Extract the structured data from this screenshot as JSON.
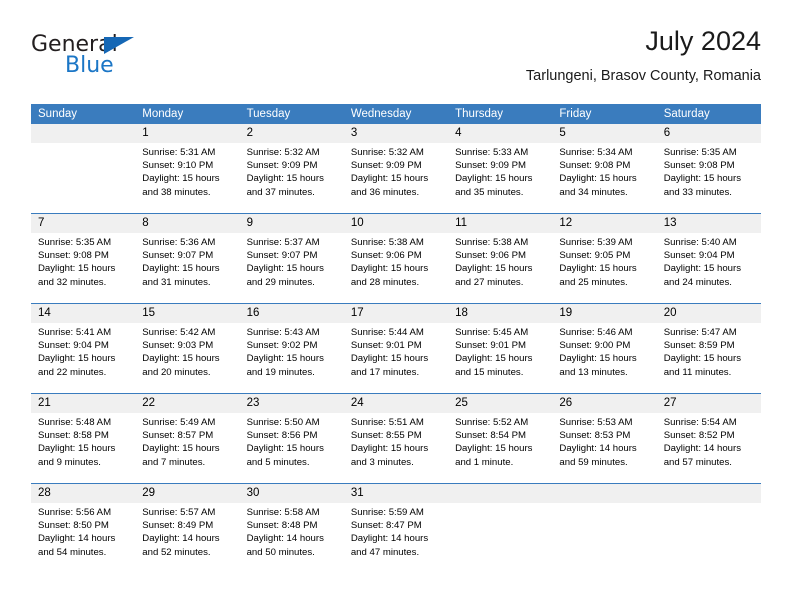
{
  "logo": {
    "word_one": "General",
    "word_two": "Blue",
    "triangle_color": "#1567b5",
    "blue_color": "#1b76c6"
  },
  "header": {
    "title": "July 2024",
    "subtitle": "Tarlungeni, Brasov County, Romania"
  },
  "theme": {
    "header_blue": "#3a7cbe",
    "date_band_gray": "#f0f0f0",
    "text_color": "#000000"
  },
  "calendar": {
    "weekday_headers": [
      "Sunday",
      "Monday",
      "Tuesday",
      "Wednesday",
      "Thursday",
      "Friday",
      "Saturday"
    ],
    "weeks": [
      {
        "days": [
          {
            "date": "",
            "sunrise": "",
            "sunset": "",
            "daylight_line1": "",
            "daylight_line2": ""
          },
          {
            "date": "1",
            "sunrise": "Sunrise: 5:31 AM",
            "sunset": "Sunset: 9:10 PM",
            "daylight_line1": "Daylight: 15 hours",
            "daylight_line2": "and 38 minutes."
          },
          {
            "date": "2",
            "sunrise": "Sunrise: 5:32 AM",
            "sunset": "Sunset: 9:09 PM",
            "daylight_line1": "Daylight: 15 hours",
            "daylight_line2": "and 37 minutes."
          },
          {
            "date": "3",
            "sunrise": "Sunrise: 5:32 AM",
            "sunset": "Sunset: 9:09 PM",
            "daylight_line1": "Daylight: 15 hours",
            "daylight_line2": "and 36 minutes."
          },
          {
            "date": "4",
            "sunrise": "Sunrise: 5:33 AM",
            "sunset": "Sunset: 9:09 PM",
            "daylight_line1": "Daylight: 15 hours",
            "daylight_line2": "and 35 minutes."
          },
          {
            "date": "5",
            "sunrise": "Sunrise: 5:34 AM",
            "sunset": "Sunset: 9:08 PM",
            "daylight_line1": "Daylight: 15 hours",
            "daylight_line2": "and 34 minutes."
          },
          {
            "date": "6",
            "sunrise": "Sunrise: 5:35 AM",
            "sunset": "Sunset: 9:08 PM",
            "daylight_line1": "Daylight: 15 hours",
            "daylight_line2": "and 33 minutes."
          }
        ]
      },
      {
        "days": [
          {
            "date": "7",
            "sunrise": "Sunrise: 5:35 AM",
            "sunset": "Sunset: 9:08 PM",
            "daylight_line1": "Daylight: 15 hours",
            "daylight_line2": "and 32 minutes."
          },
          {
            "date": "8",
            "sunrise": "Sunrise: 5:36 AM",
            "sunset": "Sunset: 9:07 PM",
            "daylight_line1": "Daylight: 15 hours",
            "daylight_line2": "and 31 minutes."
          },
          {
            "date": "9",
            "sunrise": "Sunrise: 5:37 AM",
            "sunset": "Sunset: 9:07 PM",
            "daylight_line1": "Daylight: 15 hours",
            "daylight_line2": "and 29 minutes."
          },
          {
            "date": "10",
            "sunrise": "Sunrise: 5:38 AM",
            "sunset": "Sunset: 9:06 PM",
            "daylight_line1": "Daylight: 15 hours",
            "daylight_line2": "and 28 minutes."
          },
          {
            "date": "11",
            "sunrise": "Sunrise: 5:38 AM",
            "sunset": "Sunset: 9:06 PM",
            "daylight_line1": "Daylight: 15 hours",
            "daylight_line2": "and 27 minutes."
          },
          {
            "date": "12",
            "sunrise": "Sunrise: 5:39 AM",
            "sunset": "Sunset: 9:05 PM",
            "daylight_line1": "Daylight: 15 hours",
            "daylight_line2": "and 25 minutes."
          },
          {
            "date": "13",
            "sunrise": "Sunrise: 5:40 AM",
            "sunset": "Sunset: 9:04 PM",
            "daylight_line1": "Daylight: 15 hours",
            "daylight_line2": "and 24 minutes."
          }
        ]
      },
      {
        "days": [
          {
            "date": "14",
            "sunrise": "Sunrise: 5:41 AM",
            "sunset": "Sunset: 9:04 PM",
            "daylight_line1": "Daylight: 15 hours",
            "daylight_line2": "and 22 minutes."
          },
          {
            "date": "15",
            "sunrise": "Sunrise: 5:42 AM",
            "sunset": "Sunset: 9:03 PM",
            "daylight_line1": "Daylight: 15 hours",
            "daylight_line2": "and 20 minutes."
          },
          {
            "date": "16",
            "sunrise": "Sunrise: 5:43 AM",
            "sunset": "Sunset: 9:02 PM",
            "daylight_line1": "Daylight: 15 hours",
            "daylight_line2": "and 19 minutes."
          },
          {
            "date": "17",
            "sunrise": "Sunrise: 5:44 AM",
            "sunset": "Sunset: 9:01 PM",
            "daylight_line1": "Daylight: 15 hours",
            "daylight_line2": "and 17 minutes."
          },
          {
            "date": "18",
            "sunrise": "Sunrise: 5:45 AM",
            "sunset": "Sunset: 9:01 PM",
            "daylight_line1": "Daylight: 15 hours",
            "daylight_line2": "and 15 minutes."
          },
          {
            "date": "19",
            "sunrise": "Sunrise: 5:46 AM",
            "sunset": "Sunset: 9:00 PM",
            "daylight_line1": "Daylight: 15 hours",
            "daylight_line2": "and 13 minutes."
          },
          {
            "date": "20",
            "sunrise": "Sunrise: 5:47 AM",
            "sunset": "Sunset: 8:59 PM",
            "daylight_line1": "Daylight: 15 hours",
            "daylight_line2": "and 11 minutes."
          }
        ]
      },
      {
        "days": [
          {
            "date": "21",
            "sunrise": "Sunrise: 5:48 AM",
            "sunset": "Sunset: 8:58 PM",
            "daylight_line1": "Daylight: 15 hours",
            "daylight_line2": "and 9 minutes."
          },
          {
            "date": "22",
            "sunrise": "Sunrise: 5:49 AM",
            "sunset": "Sunset: 8:57 PM",
            "daylight_line1": "Daylight: 15 hours",
            "daylight_line2": "and 7 minutes."
          },
          {
            "date": "23",
            "sunrise": "Sunrise: 5:50 AM",
            "sunset": "Sunset: 8:56 PM",
            "daylight_line1": "Daylight: 15 hours",
            "daylight_line2": "and 5 minutes."
          },
          {
            "date": "24",
            "sunrise": "Sunrise: 5:51 AM",
            "sunset": "Sunset: 8:55 PM",
            "daylight_line1": "Daylight: 15 hours",
            "daylight_line2": "and 3 minutes."
          },
          {
            "date": "25",
            "sunrise": "Sunrise: 5:52 AM",
            "sunset": "Sunset: 8:54 PM",
            "daylight_line1": "Daylight: 15 hours",
            "daylight_line2": "and 1 minute."
          },
          {
            "date": "26",
            "sunrise": "Sunrise: 5:53 AM",
            "sunset": "Sunset: 8:53 PM",
            "daylight_line1": "Daylight: 14 hours",
            "daylight_line2": "and 59 minutes."
          },
          {
            "date": "27",
            "sunrise": "Sunrise: 5:54 AM",
            "sunset": "Sunset: 8:52 PM",
            "daylight_line1": "Daylight: 14 hours",
            "daylight_line2": "and 57 minutes."
          }
        ]
      },
      {
        "days": [
          {
            "date": "28",
            "sunrise": "Sunrise: 5:56 AM",
            "sunset": "Sunset: 8:50 PM",
            "daylight_line1": "Daylight: 14 hours",
            "daylight_line2": "and 54 minutes."
          },
          {
            "date": "29",
            "sunrise": "Sunrise: 5:57 AM",
            "sunset": "Sunset: 8:49 PM",
            "daylight_line1": "Daylight: 14 hours",
            "daylight_line2": "and 52 minutes."
          },
          {
            "date": "30",
            "sunrise": "Sunrise: 5:58 AM",
            "sunset": "Sunset: 8:48 PM",
            "daylight_line1": "Daylight: 14 hours",
            "daylight_line2": "and 50 minutes."
          },
          {
            "date": "31",
            "sunrise": "Sunrise: 5:59 AM",
            "sunset": "Sunset: 8:47 PM",
            "daylight_line1": "Daylight: 14 hours",
            "daylight_line2": "and 47 minutes."
          },
          {
            "date": "",
            "sunrise": "",
            "sunset": "",
            "daylight_line1": "",
            "daylight_line2": ""
          },
          {
            "date": "",
            "sunrise": "",
            "sunset": "",
            "daylight_line1": "",
            "daylight_line2": ""
          },
          {
            "date": "",
            "sunrise": "",
            "sunset": "",
            "daylight_line1": "",
            "daylight_line2": ""
          }
        ]
      }
    ]
  }
}
